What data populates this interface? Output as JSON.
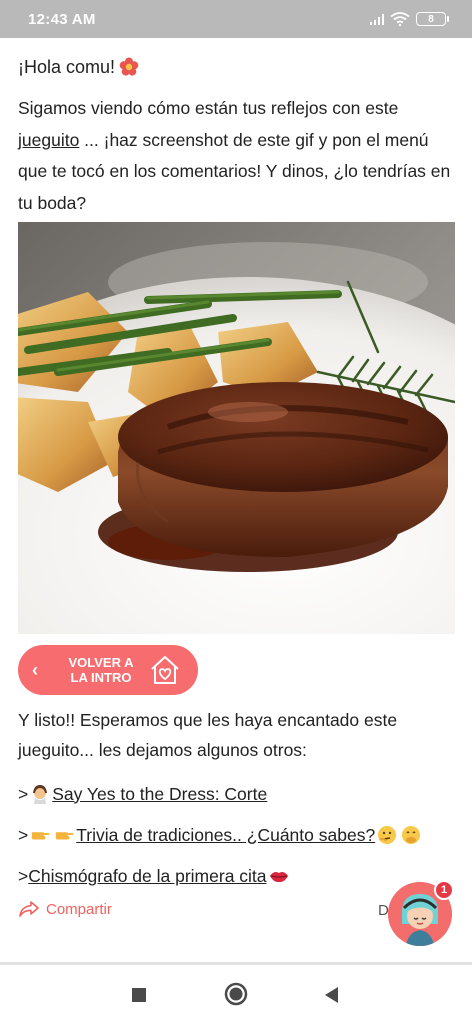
{
  "status_bar": {
    "time": "12:43 AM",
    "battery": "8"
  },
  "post": {
    "greeting": "¡Hola comu!",
    "intro_before_link": "Sigamos viendo cómo están tus reflejos con este ",
    "intro_link": "jueguito",
    "intro_after_link": " ... ¡haz screenshot de este gif y pon el menú que te tocó en los comentarios! Y dinos, ¿lo tendrías en tu boda?",
    "back_button_label": "VOLVER A LA INTRO",
    "outro": "Y listo!! Esperamos que les haya encantado este jueguito... les dejamos algunos otros:",
    "links": [
      {
        "prefix": ">",
        "label": " Say Yes to the Dress: Corte"
      },
      {
        "prefix": ">",
        "label": " Trivia de tradiciones.. ¿Cuánto sabes?"
      },
      {
        "prefix": ">",
        "label": "Chismógrafo de la primera cita"
      }
    ]
  },
  "footer": {
    "share_label": "Compartir",
    "right_letter": "D",
    "notification_count": "1"
  },
  "colors": {
    "accent": "#f76c6e",
    "status_bar": "#b9b9b9",
    "share_text": "#f0625f"
  }
}
